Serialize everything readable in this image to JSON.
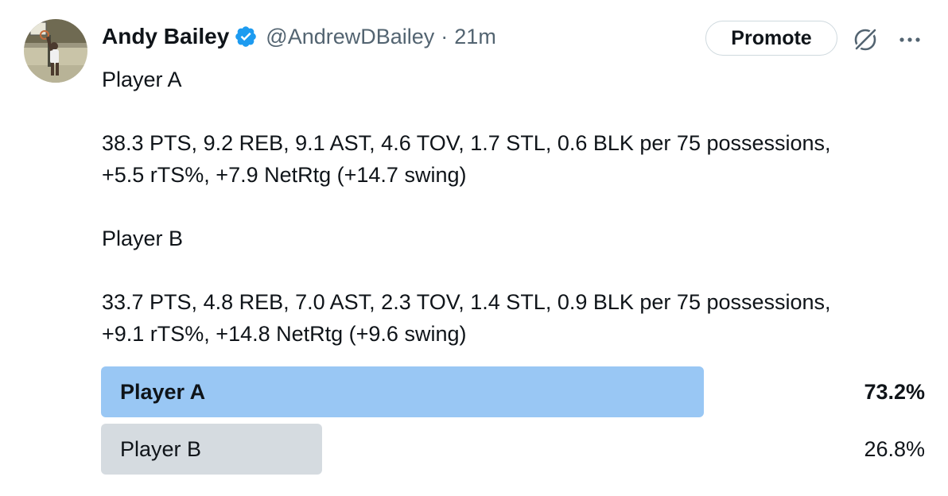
{
  "author": {
    "display_name": "Andy Bailey",
    "handle": "@AndrewDBailey",
    "separator": "·",
    "time": "21m",
    "verified": true,
    "avatar_icon": "basketball-player-avatar"
  },
  "actions": {
    "promote_label": "Promote",
    "grok_icon": "grok-icon",
    "more_icon": "more-icon"
  },
  "tweet": {
    "line1": "Player A",
    "line2": "38.3 PTS, 9.2 REB, 9.1 AST, 4.6 TOV, 1.7 STL, 0.6 BLK per 75 possessions,",
    "line3": "+5.5 rTS%, +7.9 NetRtg (+14.7 swing)",
    "line4": "Player B",
    "line5": "33.7 PTS, 4.8 REB, 7.0 AST, 2.3 TOV, 1.4 STL, 0.9 BLK per 75 possessions,",
    "line6": "+9.1 rTS%, +14.8 NetRtg (+9.6 swing)"
  },
  "poll": {
    "options": [
      {
        "label": "Player A",
        "percent_text": "73.2%",
        "percent": 73.2,
        "winner": true
      },
      {
        "label": "Player B",
        "percent_text": "26.8%",
        "percent": 26.8,
        "winner": false
      }
    ]
  },
  "colors": {
    "verified_blue": "#1d9bf0",
    "poll_winner": "#99c7f4",
    "poll_loser": "#d5dbe0",
    "secondary_text": "#536471"
  }
}
